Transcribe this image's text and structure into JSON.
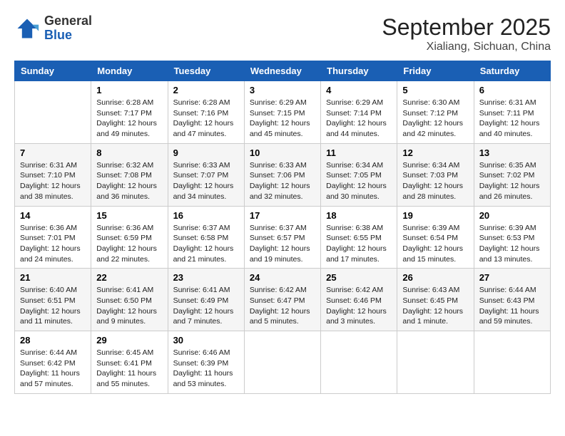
{
  "logo": {
    "line1": "General",
    "line2": "Blue"
  },
  "title": "September 2025",
  "subtitle": "Xialiang, Sichuan, China",
  "weekdays": [
    "Sunday",
    "Monday",
    "Tuesday",
    "Wednesday",
    "Thursday",
    "Friday",
    "Saturday"
  ],
  "weeks": [
    [
      {
        "day": "",
        "info": ""
      },
      {
        "day": "1",
        "info": "Sunrise: 6:28 AM\nSunset: 7:17 PM\nDaylight: 12 hours\nand 49 minutes."
      },
      {
        "day": "2",
        "info": "Sunrise: 6:28 AM\nSunset: 7:16 PM\nDaylight: 12 hours\nand 47 minutes."
      },
      {
        "day": "3",
        "info": "Sunrise: 6:29 AM\nSunset: 7:15 PM\nDaylight: 12 hours\nand 45 minutes."
      },
      {
        "day": "4",
        "info": "Sunrise: 6:29 AM\nSunset: 7:14 PM\nDaylight: 12 hours\nand 44 minutes."
      },
      {
        "day": "5",
        "info": "Sunrise: 6:30 AM\nSunset: 7:12 PM\nDaylight: 12 hours\nand 42 minutes."
      },
      {
        "day": "6",
        "info": "Sunrise: 6:31 AM\nSunset: 7:11 PM\nDaylight: 12 hours\nand 40 minutes."
      }
    ],
    [
      {
        "day": "7",
        "info": "Sunrise: 6:31 AM\nSunset: 7:10 PM\nDaylight: 12 hours\nand 38 minutes."
      },
      {
        "day": "8",
        "info": "Sunrise: 6:32 AM\nSunset: 7:08 PM\nDaylight: 12 hours\nand 36 minutes."
      },
      {
        "day": "9",
        "info": "Sunrise: 6:33 AM\nSunset: 7:07 PM\nDaylight: 12 hours\nand 34 minutes."
      },
      {
        "day": "10",
        "info": "Sunrise: 6:33 AM\nSunset: 7:06 PM\nDaylight: 12 hours\nand 32 minutes."
      },
      {
        "day": "11",
        "info": "Sunrise: 6:34 AM\nSunset: 7:05 PM\nDaylight: 12 hours\nand 30 minutes."
      },
      {
        "day": "12",
        "info": "Sunrise: 6:34 AM\nSunset: 7:03 PM\nDaylight: 12 hours\nand 28 minutes."
      },
      {
        "day": "13",
        "info": "Sunrise: 6:35 AM\nSunset: 7:02 PM\nDaylight: 12 hours\nand 26 minutes."
      }
    ],
    [
      {
        "day": "14",
        "info": "Sunrise: 6:36 AM\nSunset: 7:01 PM\nDaylight: 12 hours\nand 24 minutes."
      },
      {
        "day": "15",
        "info": "Sunrise: 6:36 AM\nSunset: 6:59 PM\nDaylight: 12 hours\nand 22 minutes."
      },
      {
        "day": "16",
        "info": "Sunrise: 6:37 AM\nSunset: 6:58 PM\nDaylight: 12 hours\nand 21 minutes."
      },
      {
        "day": "17",
        "info": "Sunrise: 6:37 AM\nSunset: 6:57 PM\nDaylight: 12 hours\nand 19 minutes."
      },
      {
        "day": "18",
        "info": "Sunrise: 6:38 AM\nSunset: 6:55 PM\nDaylight: 12 hours\nand 17 minutes."
      },
      {
        "day": "19",
        "info": "Sunrise: 6:39 AM\nSunset: 6:54 PM\nDaylight: 12 hours\nand 15 minutes."
      },
      {
        "day": "20",
        "info": "Sunrise: 6:39 AM\nSunset: 6:53 PM\nDaylight: 12 hours\nand 13 minutes."
      }
    ],
    [
      {
        "day": "21",
        "info": "Sunrise: 6:40 AM\nSunset: 6:51 PM\nDaylight: 12 hours\nand 11 minutes."
      },
      {
        "day": "22",
        "info": "Sunrise: 6:41 AM\nSunset: 6:50 PM\nDaylight: 12 hours\nand 9 minutes."
      },
      {
        "day": "23",
        "info": "Sunrise: 6:41 AM\nSunset: 6:49 PM\nDaylight: 12 hours\nand 7 minutes."
      },
      {
        "day": "24",
        "info": "Sunrise: 6:42 AM\nSunset: 6:47 PM\nDaylight: 12 hours\nand 5 minutes."
      },
      {
        "day": "25",
        "info": "Sunrise: 6:42 AM\nSunset: 6:46 PM\nDaylight: 12 hours\nand 3 minutes."
      },
      {
        "day": "26",
        "info": "Sunrise: 6:43 AM\nSunset: 6:45 PM\nDaylight: 12 hours\nand 1 minute."
      },
      {
        "day": "27",
        "info": "Sunrise: 6:44 AM\nSunset: 6:43 PM\nDaylight: 11 hours\nand 59 minutes."
      }
    ],
    [
      {
        "day": "28",
        "info": "Sunrise: 6:44 AM\nSunset: 6:42 PM\nDaylight: 11 hours\nand 57 minutes."
      },
      {
        "day": "29",
        "info": "Sunrise: 6:45 AM\nSunset: 6:41 PM\nDaylight: 11 hours\nand 55 minutes."
      },
      {
        "day": "30",
        "info": "Sunrise: 6:46 AM\nSunset: 6:39 PM\nDaylight: 11 hours\nand 53 minutes."
      },
      {
        "day": "",
        "info": ""
      },
      {
        "day": "",
        "info": ""
      },
      {
        "day": "",
        "info": ""
      },
      {
        "day": "",
        "info": ""
      }
    ]
  ]
}
